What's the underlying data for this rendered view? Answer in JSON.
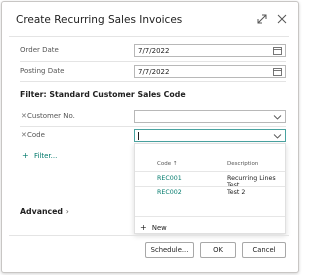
{
  "dialog": {
    "title": "Create Recurring Sales Invoices"
  },
  "fields": {
    "order_date": {
      "label": "Order Date",
      "value": "7/7/2022"
    },
    "posting_date": {
      "label": "Posting Date",
      "value": "7/7/2022"
    }
  },
  "filter_section": {
    "title": "Filter: Standard Customer Sales Code",
    "customer_no_label": "Customer No.",
    "customer_no_value": "",
    "code_label": "Code",
    "code_value": "",
    "add_filter_label": "Filter..."
  },
  "dropdown": {
    "columns": [
      "Code ↑",
      "Description"
    ],
    "rows": [
      {
        "code": "REC001",
        "description": "Recurring Lines Test"
      },
      {
        "code": "REC002",
        "description": "Test 2"
      }
    ],
    "new_label": "New"
  },
  "advanced_label": "Advanced",
  "buttons": {
    "schedule": "Schedule...",
    "ok": "OK",
    "cancel": "Cancel"
  },
  "colors": {
    "accent": "#00796b",
    "focus_border": "#4aa3a0"
  }
}
